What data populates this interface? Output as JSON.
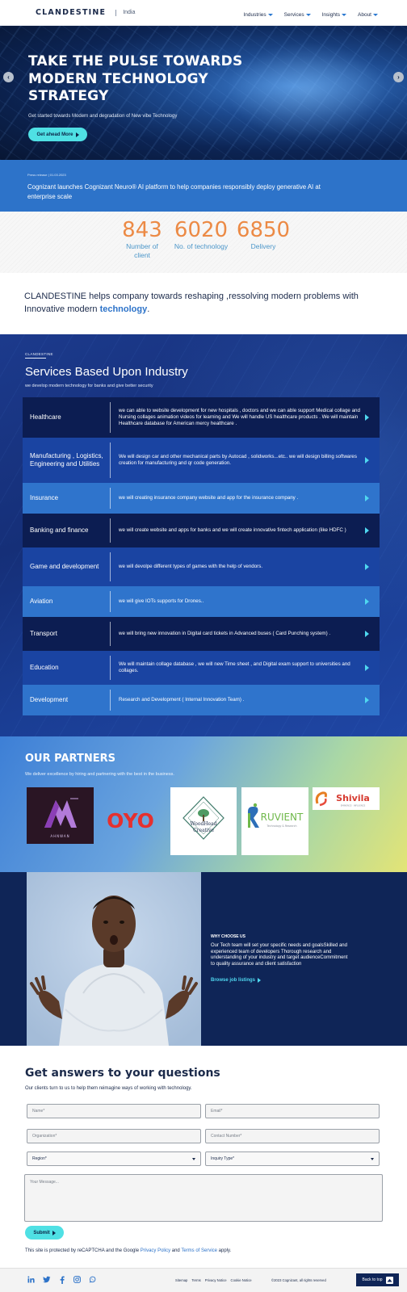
{
  "header": {
    "logo": "CLANDESTINE",
    "region": "India",
    "nav": [
      "Industries",
      "Services",
      "Insights",
      "About"
    ]
  },
  "hero": {
    "title_lines": [
      "TAKE THE PULSE TOWARDS",
      "MODERN TECHNOLOGY",
      "STRATEGY"
    ],
    "subtitle": "Get started towards Modern and degradation of New vibe Technology",
    "cta": "Get ahead More",
    "prev_icon": "chevron-left-icon",
    "next_icon": "chevron-right-icon"
  },
  "press": {
    "date": "Press release | 01.03.2023",
    "text": "Cognizant launches Cognizant Neuro® AI platform to help companies responsibly deploy generative AI at enterprise scale"
  },
  "stats": [
    {
      "value": "843",
      "label": "Number of client"
    },
    {
      "value": "6020",
      "label": "No. of technology"
    },
    {
      "value": "6850",
      "label": "Delivery"
    }
  ],
  "statement": {
    "text": "CLANDESTINE helps company towards reshaping ,ressolving modern problems with Innovative modern ",
    "highlight": "technology",
    "end": "."
  },
  "services": {
    "eyebrow": "CLANDESTINE",
    "title": "Services Based Upon Industry",
    "subtitle": "we develop modern technology for banks and give better security",
    "rows": [
      {
        "name": "Healthcare",
        "desc": "we can able to website development for new hospitals , doctors and we can able support Medical collage and Nursing collages animation videos for learning and We will handle US healthcare products . We will maintain Healthcare database for American mercy healthcare ."
      },
      {
        "name": "Manufacturing , Logistics, Engineering and Utilities",
        "desc": "We will design car and other mechanical parts by Autocad , solidworks...etc.. we will design billing softwares creation for manufacturing and qr code generation."
      },
      {
        "name": "Insurance",
        "desc": "we will creating insurance company website and app for the insurance company ."
      },
      {
        "name": "Banking and finance",
        "desc": "we will create website and apps for banks and we will create innovative fintech application (like HDFC )"
      },
      {
        "name": "Game and development",
        "desc": "we will devolpe different types of games with the help of vendors."
      },
      {
        "name": "Aviation",
        "desc": "we will give IOTs supports for Drones.."
      },
      {
        "name": "Transport",
        "desc": "we will bring new innovation in Digital card tickets in Advanced buses ( Card Punching system) ."
      },
      {
        "name": "Education",
        "desc": "We will maintain collage database , we will new Time sheet , and Digital exam support to universities and collages."
      },
      {
        "name": "Development",
        "desc": "Research and Development ( Internal Innovation Team) ."
      }
    ]
  },
  "partners": {
    "title": "OUR PARTNERS",
    "subtitle": "We deliver excellence by hiring and partnering with the best in the business.",
    "logos": [
      "AHNWAN",
      "OYO",
      "WoodHead Creative",
      "RUVIENT",
      "Shivila"
    ],
    "logo_sublines": {
      "ruvient": "Technology & Research",
      "shivila": "EMINENCE · INFLUENCE"
    }
  },
  "why": {
    "eyebrow": "WHY CHOOSE US",
    "text": "Our Tech team will set your specific needs and goalsSkilled and experienced team of developers Thorough research and understanding of your industry and target audienceCommitment to quality assurance and client satisfaction",
    "link": "Browse job listings"
  },
  "form": {
    "title": "Get answers to your questions",
    "subtitle": "Our clients turn to us to help them reimagine ways of working with technology.",
    "name_ph": "Name*",
    "email_ph": "Email*",
    "org_ph": "Organization*",
    "contact_ph": "Contact Number*",
    "region": "Region*",
    "inquiry": "Inquiry Type*",
    "message_ph": "Your Message...",
    "submit": "Submit",
    "recaptcha_pre": "This site is protected by reCAPTCHA and the Google ",
    "privacy": "Privacy Policy",
    "and": " and ",
    "terms": "Terms of Service",
    "recaptcha_post": " apply."
  },
  "footer": {
    "social": [
      "linkedin-icon",
      "twitter-icon",
      "facebook-icon",
      "instagram-icon",
      "whatsapp-icon"
    ],
    "links": [
      "Sitemap",
      "Terms",
      "Privacy Notice",
      "Cookie Notice"
    ],
    "copyright": "©2023 Cognizant, all rights reserved",
    "back_to_top": "Back to top"
  },
  "colors": {
    "accent": "#2d73c9",
    "cta": "#4fe0e4",
    "stat": "#ec8a45",
    "navy": "#0f2557"
  }
}
